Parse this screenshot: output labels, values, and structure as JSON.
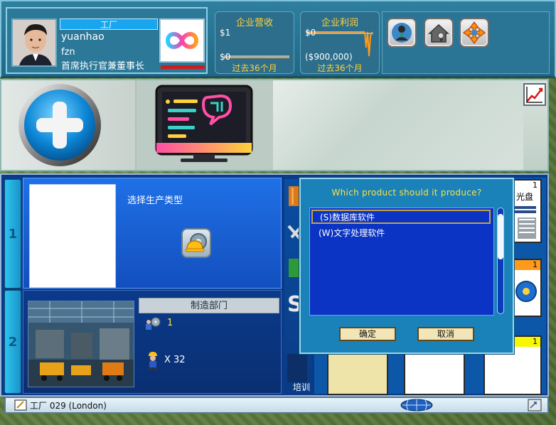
{
  "profile": {
    "company_type": "工厂",
    "ceo_name": "yuanhao",
    "company_name": "fzn",
    "ceo_title": "首席执行官兼董事长"
  },
  "revenue": {
    "title": "企业营收",
    "top_label": "$1",
    "bottom_label": "$0",
    "period": "过去36个月"
  },
  "profit": {
    "title": "企业利润",
    "top_label": "$0",
    "bottom_label": "($900,000)",
    "period": "过去36个月"
  },
  "toolbar": {
    "icons": [
      "manager-icon",
      "house-key-icon",
      "move-arrows-icon"
    ]
  },
  "main": {
    "section1": {
      "tab_number": "1",
      "choose_label": "选择生产类型"
    },
    "section2": {
      "tab_number": "2",
      "dept_label": "制造部门",
      "dept_count": "1",
      "worker_count": "X 32"
    },
    "train_label": "培训",
    "cards": [
      {
        "num": "1",
        "label": "光盘",
        "header_color": "#ffffff"
      },
      {
        "num": "1",
        "label": "",
        "header_color": "#ff9a1a"
      },
      {
        "num": "1",
        "label": "",
        "header_color": "#f7f700"
      }
    ]
  },
  "dialog": {
    "question": "Which product should it produce?",
    "options": [
      "(S)数据库软件",
      "(W)文字处理软件"
    ],
    "selected_index": 0,
    "ok_label": "确定",
    "cancel_label": "取消"
  },
  "statusbar": {
    "text": "工厂  029  (London)"
  },
  "colors": {
    "accent_yellow": "#ffe044",
    "panel_blue": "#1f70e6",
    "dialog_blue": "#1a82b8"
  }
}
